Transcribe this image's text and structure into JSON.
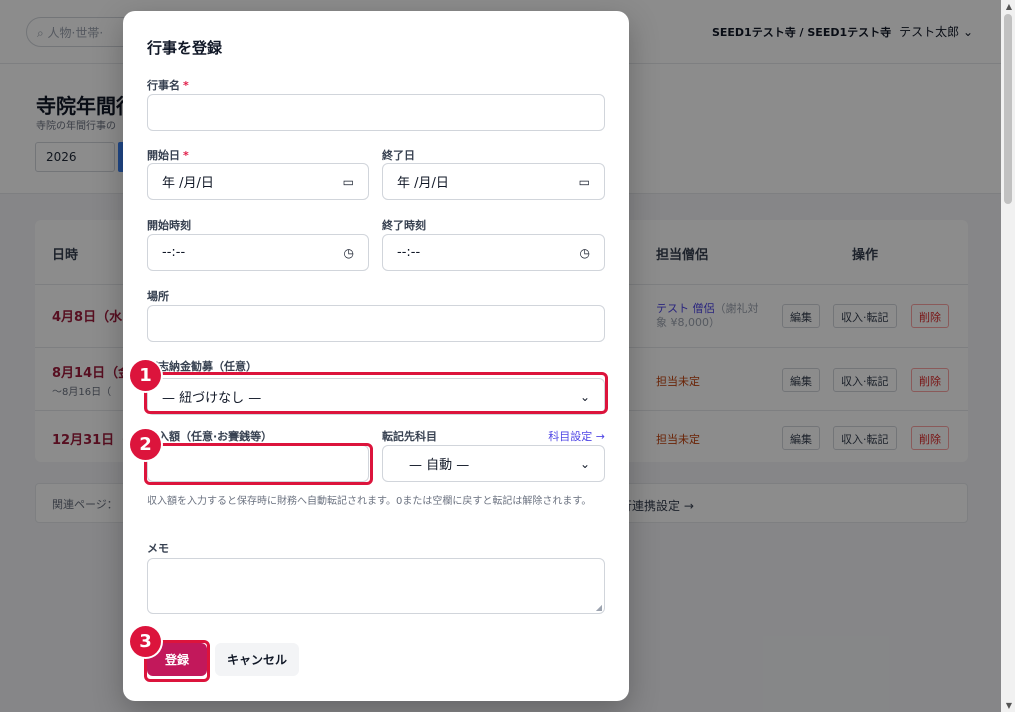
{
  "topbar": {
    "search_placeholder": "人物·世帯·",
    "tenant": "SEED1テスト寺 / SEED1テスト寺",
    "user": "テスト太郎 ⌄"
  },
  "page": {
    "title": "寺院年間行",
    "subtitle": "寺院の年間行事の",
    "year": "2026"
  },
  "table": {
    "col_date": "日時",
    "col_monk": "担当僧侶",
    "col_actions": "操作",
    "rows": [
      {
        "date": "4月8日（水",
        "date_sub": "",
        "monk_link": "テスト 僧侶",
        "monk_note": "（謝礼対象 ¥8,000）"
      },
      {
        "date": "8月14日（金",
        "date_sub": "〜8月16日（",
        "monk_unassigned": "担当未定"
      },
      {
        "date": "12月31日（",
        "date_sub": "",
        "monk_unassigned": "担当未定"
      }
    ],
    "btn_edit": "編集",
    "btn_income": "収入·転記",
    "btn_delete": "削除"
  },
  "related": {
    "label": "関連ページ：",
    "right": "行連携設定 →"
  },
  "modal": {
    "title": "行事を登録",
    "name_label": "行事名",
    "req_mark": "*",
    "start_date_label": "開始日",
    "end_date_label": "終了日",
    "date_placeholder": "年 /月/日",
    "start_time_label": "開始時刻",
    "end_time_label": "終了時刻",
    "time_placeholder": "--:--",
    "place_label": "場所",
    "campaign_label": "篤志納金勧募（任意）",
    "campaign_value": "— 紐づけなし —",
    "amount_label": "収入額（任意·お賽銭等）",
    "account_label": "転記先科目",
    "account_link": "科目設定 →",
    "account_value": "— 自動 —",
    "hint": "収入額を入力すると保存時に財務へ自動転記されます。0または空欄に戻すと転記は解除されます。",
    "memo_label": "メモ",
    "submit": "登録",
    "cancel": "キャンセル"
  },
  "annotations": {
    "badge1": "1",
    "badge2": "2",
    "badge3": "3",
    "color": "#dc143c"
  }
}
